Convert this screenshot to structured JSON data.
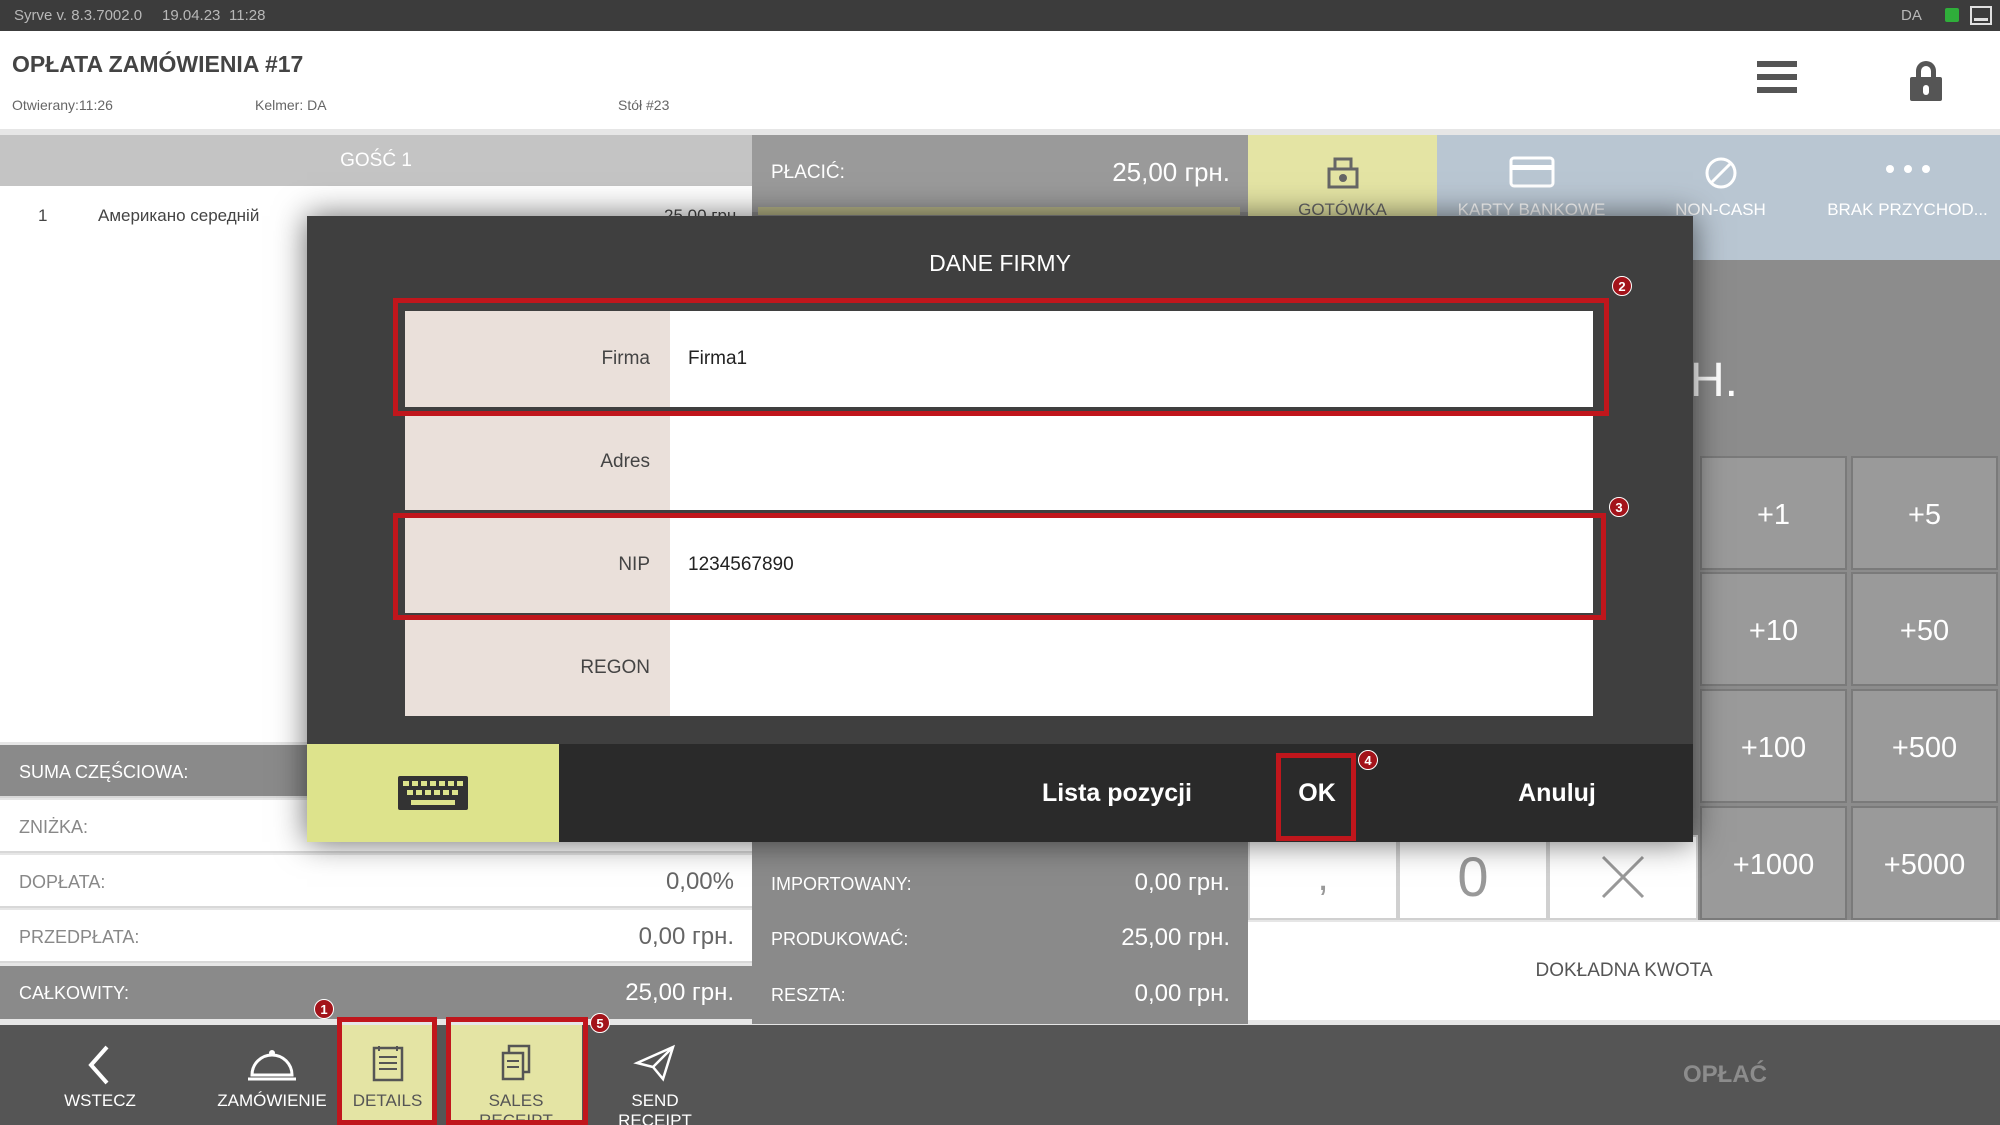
{
  "status_bar": {
    "app_version": "Syrve  v. 8.3.7002.0",
    "date": "19.04.23",
    "time": "11:28",
    "user": "DA"
  },
  "header": {
    "title": "OPŁATA ZAMÓWIENIA #17",
    "opened": "Otwierany:11:26",
    "waiter": "Kelmer: DA",
    "table": "Stół #23"
  },
  "guest": {
    "header": "GOŚĆ 1",
    "items": [
      {
        "qty": "1",
        "name": "Американо середній",
        "price": "25,00 грн."
      }
    ]
  },
  "summary": {
    "subtotal_label": "SUMA CZĘŚCIOWA:",
    "discount_label": "ZNIŻKA:",
    "surcharge_label": "DOPŁATA:",
    "surcharge_value": "0,00%",
    "prepayment_label": "PRZEDPŁATA:",
    "prepayment_value": "0,00 грн.",
    "total_label": "CAŁKOWITY:",
    "total_value": "25,00 грн."
  },
  "payment": {
    "to_pay_label": "PŁACIĆ:",
    "to_pay_value": "25,00 грн.",
    "imported_label": "IMPORTOWANY:",
    "imported_value": "0,00 грн.",
    "produce_label": "PRODUKOWAĆ:",
    "produce_value": "25,00 грн.",
    "change_label": "RESZTA:",
    "change_value": "0,00 грн.",
    "amount_partial": "H."
  },
  "payment_types": [
    {
      "label": "GOTÓWKA",
      "icon": "cash-register-icon"
    },
    {
      "label": "KARTY BANKOWE",
      "icon": "credit-card-icon"
    },
    {
      "label": "NON-CASH",
      "icon": "non-cash-icon"
    },
    {
      "label": "BRAK PRZYCHOD...",
      "icon": "more-dots-icon"
    }
  ],
  "quick_amounts": [
    "+1",
    "+5",
    "+10",
    "+50",
    "+100",
    "+500",
    "+1000",
    "+5000"
  ],
  "keypad": {
    "comma": ",",
    "zero": "0",
    "exact_label": "DOKŁADNA KWOTA"
  },
  "dialog": {
    "title": "DANE FIRMY",
    "fields": [
      {
        "label": "Firma",
        "value": "Firma1"
      },
      {
        "label": "Adres",
        "value": ""
      },
      {
        "label": "NIP",
        "value": "1234567890"
      },
      {
        "label": "REGON",
        "value": ""
      }
    ],
    "list_button": "Lista pozycji",
    "ok_button": "OK",
    "cancel_button": "Anuluj"
  },
  "toolbar": {
    "back": "WSTECZ",
    "order": "ZAMÓWIENIE",
    "details": "DETAILS",
    "sales_receipt": "SALES RECEIPT",
    "send_receipt": "SEND RECEIPT",
    "pay": "OPŁAĆ"
  },
  "annotations": [
    "1",
    "2",
    "3",
    "4",
    "5"
  ],
  "colors": {
    "highlight": "#e4e4a4",
    "annotation_red": "#c0161c",
    "keyboard_button": "#dde38c"
  }
}
